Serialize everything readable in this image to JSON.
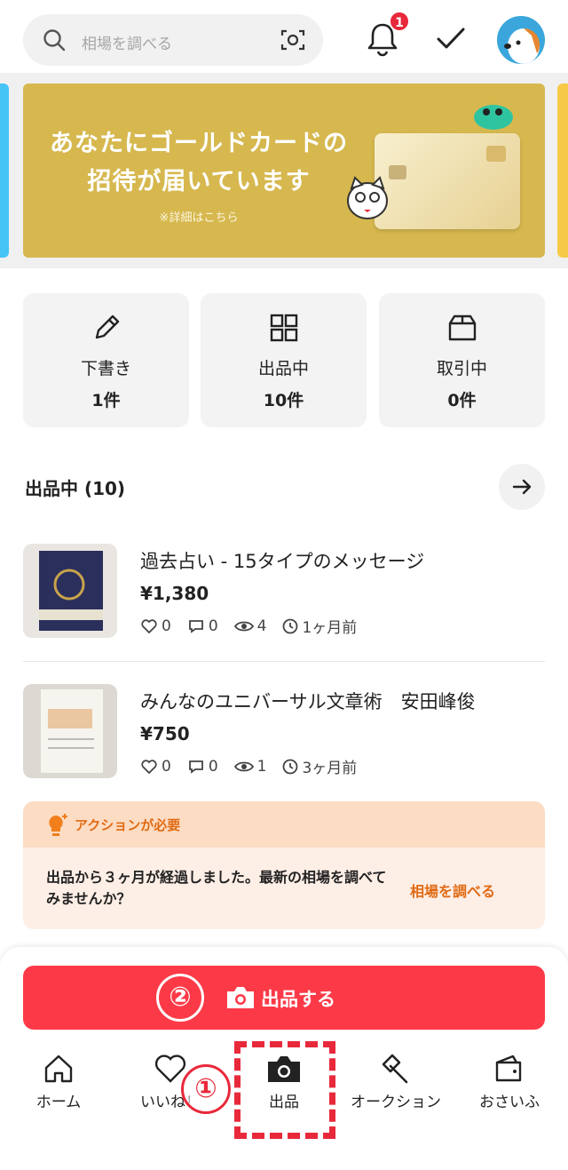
{
  "header": {
    "search_placeholder": "相場を調べる",
    "notification_count": "1"
  },
  "banner": {
    "line1": "あなたにゴールドカードの",
    "line2": "招待が届いています",
    "sub": "※詳細はこちら"
  },
  "tiles": [
    {
      "label": "下書き",
      "count": "1件"
    },
    {
      "label": "出品中",
      "count": "10件"
    },
    {
      "label": "取引中",
      "count": "0件"
    }
  ],
  "listing": {
    "title": "出品中 (10)",
    "items": [
      {
        "name": "過去占い - 15タイプのメッセージ",
        "price": "¥1,380",
        "likes": "0",
        "comments": "0",
        "views": "4",
        "time": "1ヶ月前"
      },
      {
        "name": "みんなのユニバーサル文章術　安田峰俊",
        "price": "¥750",
        "likes": "0",
        "comments": "0",
        "views": "1",
        "time": "3ヶ月前"
      }
    ]
  },
  "action": {
    "title": "アクションが必要",
    "body": "出品から３ヶ月が経過しました。最新の相場を調べてみませんか？",
    "link": "相場を調べる"
  },
  "sell_button": {
    "label": "出品する",
    "step": "②"
  },
  "nav": [
    {
      "label": "ホーム"
    },
    {
      "label": "いいね！"
    },
    {
      "label": "出品"
    },
    {
      "label": "オークション"
    },
    {
      "label": "おさいふ"
    }
  ],
  "overlay": {
    "step": "①"
  },
  "colors": {
    "accent": "#fc3a47",
    "banner": "#d6b84f",
    "action_orange": "#e06a13"
  }
}
